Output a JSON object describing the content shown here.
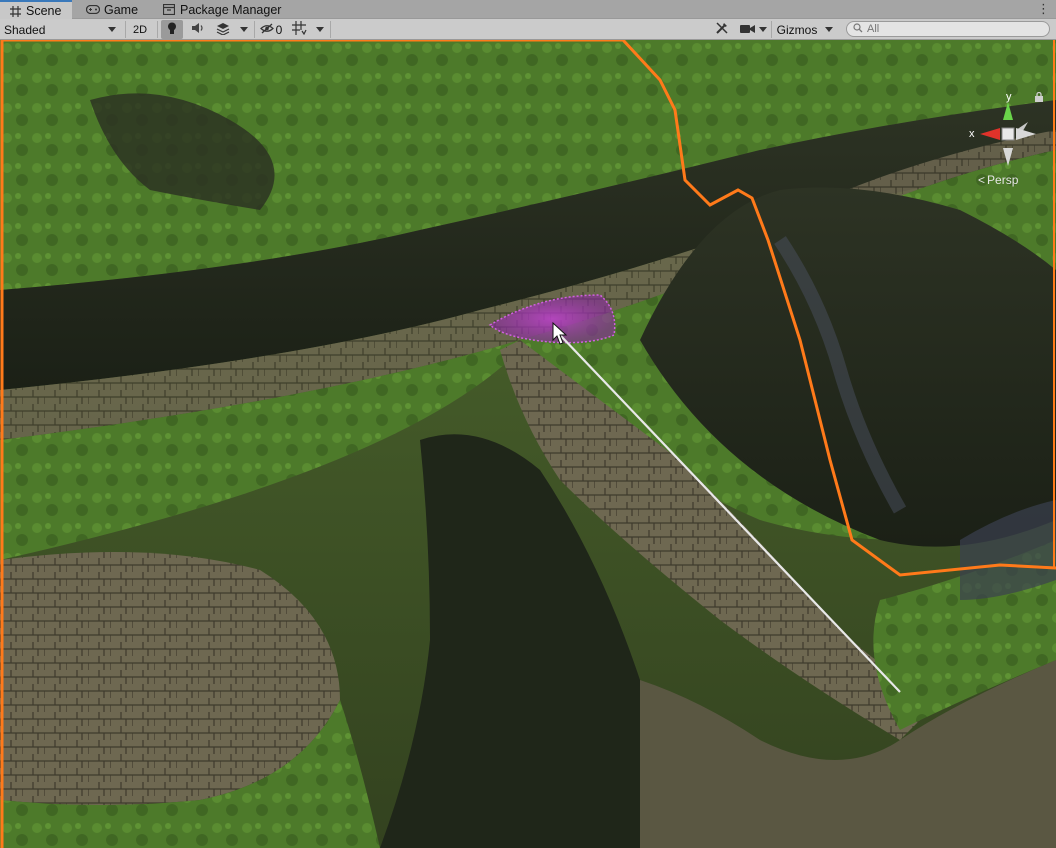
{
  "tabs": [
    {
      "label": "Scene",
      "icon": "grid-icon",
      "active": true
    },
    {
      "label": "Game",
      "icon": "gamepad-icon",
      "active": false
    },
    {
      "label": "Package Manager",
      "icon": "package-icon",
      "active": false
    }
  ],
  "toolbar": {
    "draw_mode": "Shaded",
    "mode_2d": "2D",
    "hidden_count": "0",
    "gizmos": "Gizmos",
    "search_placeholder": "All"
  },
  "scene_gizmo": {
    "y_axis": "y",
    "x_axis": "x",
    "projection": "Persp"
  },
  "colors": {
    "selection_outline": "#ff7a1a",
    "brush": "#b040c0",
    "tab_accent": "#3a79bb"
  }
}
